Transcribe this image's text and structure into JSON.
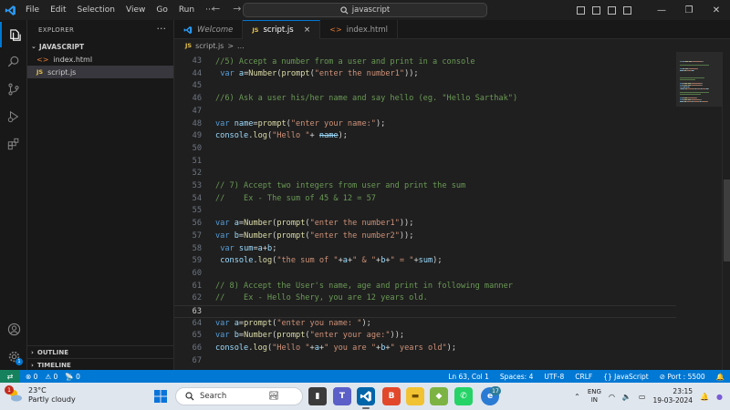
{
  "titlebar": {
    "menus": [
      "File",
      "Edit",
      "Selection",
      "View",
      "Go",
      "Run",
      "···"
    ],
    "search": "javascript",
    "back": "←",
    "forward": "→",
    "minimize": "—",
    "maximize": "❐",
    "close": "✕"
  },
  "sidebar": {
    "title": "EXPLORER",
    "more": "···",
    "folder": "JAVASCRIPT",
    "files": [
      {
        "icon": "<>",
        "name": "index.html"
      },
      {
        "icon": "JS",
        "name": "script.js"
      }
    ],
    "outline": "OUTLINE",
    "timeline": "TIMELINE"
  },
  "tabs": [
    {
      "label": "Welcome",
      "icon": "vscode"
    },
    {
      "label": "script.js",
      "icon": "JS",
      "close": "×"
    },
    {
      "label": "index.html",
      "icon": "<>"
    }
  ],
  "breadcrumb": {
    "icon": "JS",
    "file": "script.js",
    "sep": ">",
    "rest": "..."
  },
  "editor": {
    "top_fragment": "//5) Accept a number from a user and print in a console",
    "current_line": 63,
    "lines": [
      {
        "n": "43",
        "tokens": []
      },
      {
        "n": "44",
        "tokens": [
          {
            "t": " "
          },
          {
            "t": "var",
            "c": "kw"
          },
          {
            "t": " "
          },
          {
            "t": "a",
            "c": "var"
          },
          {
            "t": "="
          },
          {
            "t": "Number",
            "c": "fn"
          },
          {
            "t": "("
          },
          {
            "t": "prompt",
            "c": "fn"
          },
          {
            "t": "("
          },
          {
            "t": "\"enter the number1\"",
            "c": "str"
          },
          {
            "t": "));"
          }
        ]
      },
      {
        "n": "45",
        "tokens": []
      },
      {
        "n": "46",
        "tokens": [
          {
            "t": "//6) Ask a user his/her name and say hello (eg. \"Hello Sarthak\")",
            "c": "cm"
          }
        ]
      },
      {
        "n": "47",
        "tokens": []
      },
      {
        "n": "48",
        "tokens": [
          {
            "t": "var",
            "c": "kw"
          },
          {
            "t": " "
          },
          {
            "t": "name",
            "c": "var"
          },
          {
            "t": "="
          },
          {
            "t": "prompt",
            "c": "fn"
          },
          {
            "t": "("
          },
          {
            "t": "\"enter your name:\"",
            "c": "str"
          },
          {
            "t": ");"
          }
        ]
      },
      {
        "n": "49",
        "tokens": [
          {
            "t": "console",
            "c": "var"
          },
          {
            "t": "."
          },
          {
            "t": "log",
            "c": "fn"
          },
          {
            "t": "("
          },
          {
            "t": "\"Hello \"",
            "c": "str"
          },
          {
            "t": "+ "
          },
          {
            "t": "name",
            "c": "var strike"
          },
          {
            "t": ");"
          }
        ]
      },
      {
        "n": "50",
        "tokens": []
      },
      {
        "n": "51",
        "tokens": []
      },
      {
        "n": "52",
        "tokens": []
      },
      {
        "n": "53",
        "tokens": [
          {
            "t": "// 7) Accept two integers from user and print the sum",
            "c": "cm"
          }
        ]
      },
      {
        "n": "54",
        "tokens": [
          {
            "t": "//    Ex - The sum of 45 & 12 = 57",
            "c": "cm"
          }
        ]
      },
      {
        "n": "55",
        "tokens": []
      },
      {
        "n": "56",
        "tokens": [
          {
            "t": "var",
            "c": "kw"
          },
          {
            "t": " "
          },
          {
            "t": "a",
            "c": "var"
          },
          {
            "t": "="
          },
          {
            "t": "Number",
            "c": "fn"
          },
          {
            "t": "("
          },
          {
            "t": "prompt",
            "c": "fn"
          },
          {
            "t": "("
          },
          {
            "t": "\"enter the number1\"",
            "c": "str"
          },
          {
            "t": "));"
          }
        ]
      },
      {
        "n": "57",
        "tokens": [
          {
            "t": "var",
            "c": "kw"
          },
          {
            "t": " "
          },
          {
            "t": "b",
            "c": "var"
          },
          {
            "t": "="
          },
          {
            "t": "Number",
            "c": "fn"
          },
          {
            "t": "("
          },
          {
            "t": "prompt",
            "c": "fn"
          },
          {
            "t": "("
          },
          {
            "t": "\"enter the number2\"",
            "c": "str"
          },
          {
            "t": "));"
          }
        ]
      },
      {
        "n": "58",
        "tokens": [
          {
            "t": " "
          },
          {
            "t": "var",
            "c": "kw"
          },
          {
            "t": " "
          },
          {
            "t": "sum",
            "c": "var"
          },
          {
            "t": "="
          },
          {
            "t": "a",
            "c": "var"
          },
          {
            "t": "+"
          },
          {
            "t": "b",
            "c": "var"
          },
          {
            "t": ";"
          }
        ]
      },
      {
        "n": "59",
        "tokens": [
          {
            "t": " "
          },
          {
            "t": "console",
            "c": "var"
          },
          {
            "t": "."
          },
          {
            "t": "log",
            "c": "fn"
          },
          {
            "t": "("
          },
          {
            "t": "\"the sum of \"",
            "c": "str"
          },
          {
            "t": "+"
          },
          {
            "t": "a",
            "c": "var"
          },
          {
            "t": "+"
          },
          {
            "t": "\" & \"",
            "c": "str"
          },
          {
            "t": "+"
          },
          {
            "t": "b",
            "c": "var"
          },
          {
            "t": "+"
          },
          {
            "t": "\" = \"",
            "c": "str"
          },
          {
            "t": "+"
          },
          {
            "t": "sum",
            "c": "var"
          },
          {
            "t": ");"
          }
        ]
      },
      {
        "n": "60",
        "tokens": []
      },
      {
        "n": "61",
        "tokens": [
          {
            "t": "// 8) Accept the User's name, age and print in following manner",
            "c": "cm"
          }
        ]
      },
      {
        "n": "62",
        "tokens": [
          {
            "t": "//    Ex - Hello Shery, you are 12 years old.",
            "c": "cm"
          }
        ]
      },
      {
        "n": "63",
        "tokens": []
      },
      {
        "n": "64",
        "tokens": [
          {
            "t": "var",
            "c": "kw"
          },
          {
            "t": " "
          },
          {
            "t": "a",
            "c": "var"
          },
          {
            "t": "="
          },
          {
            "t": "prompt",
            "c": "fn"
          },
          {
            "t": "("
          },
          {
            "t": "\"enter you name: \"",
            "c": "str"
          },
          {
            "t": ");"
          }
        ]
      },
      {
        "n": "65",
        "tokens": [
          {
            "t": "var",
            "c": "kw"
          },
          {
            "t": " "
          },
          {
            "t": "b",
            "c": "var"
          },
          {
            "t": "="
          },
          {
            "t": "Number",
            "c": "fn"
          },
          {
            "t": "("
          },
          {
            "t": "prompt",
            "c": "fn"
          },
          {
            "t": "("
          },
          {
            "t": "\"enter your age:\"",
            "c": "str"
          },
          {
            "t": "));"
          }
        ]
      },
      {
        "n": "66",
        "tokens": [
          {
            "t": "console",
            "c": "var"
          },
          {
            "t": "."
          },
          {
            "t": "log",
            "c": "fn"
          },
          {
            "t": "("
          },
          {
            "t": "\"Hello \"",
            "c": "str"
          },
          {
            "t": "+"
          },
          {
            "t": "a",
            "c": "var"
          },
          {
            "t": "+"
          },
          {
            "t": "\" you are \"",
            "c": "str"
          },
          {
            "t": "+"
          },
          {
            "t": "b",
            "c": "var"
          },
          {
            "t": "+"
          },
          {
            "t": "\" years old\"",
            "c": "str"
          },
          {
            "t": ");"
          }
        ]
      },
      {
        "n": "67",
        "tokens": []
      }
    ]
  },
  "statusbar": {
    "remote": "⇄",
    "errors": "⊗ 0",
    "warnings": "⚠ 0",
    "ports": "📡 0",
    "position": "Ln 63, Col 1",
    "spaces": "Spaces: 4",
    "encoding": "UTF-8",
    "eol": "CRLF",
    "language": "{} JavaScript",
    "port": "⊘ Port : 5500",
    "bell": "🔔"
  },
  "taskbar": {
    "weather_badge": "1",
    "temp": "23°C",
    "condition": "Partly cloudy",
    "search": "Search",
    "lang1": "ENG",
    "lang2": "IN",
    "time": "23:15",
    "date": "19-03-2024",
    "whatsapp_badge": "17"
  },
  "colors": {
    "accent": "#0078d4",
    "statusbar": "#0078d4",
    "remote": "#16825d",
    "keyword": "#569cd6",
    "variable": "#9cdcfe",
    "function": "#dcdcaa",
    "string": "#ce9178",
    "comment": "#6a9955"
  }
}
